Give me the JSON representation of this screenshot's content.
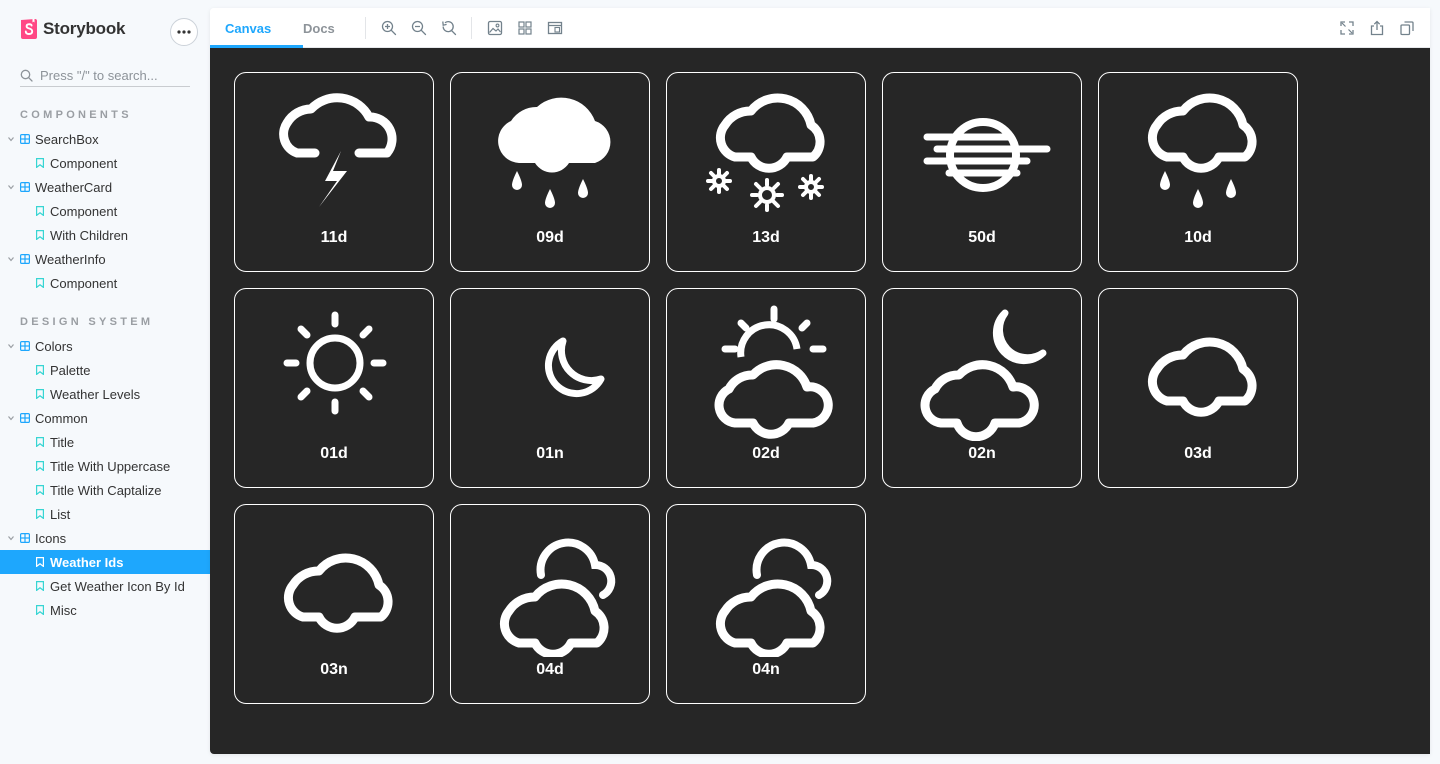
{
  "brand": {
    "name": "Storybook",
    "logo_color": "#ff4785"
  },
  "search": {
    "placeholder": "Press \"/\" to search..."
  },
  "sections": {
    "components": "COMPONENTS",
    "design_system": "DESIGN SYSTEM"
  },
  "tree": {
    "searchbox": "SearchBox",
    "searchbox_component": "Component",
    "weathercard": "WeatherCard",
    "weathercard_component": "Component",
    "weathercard_children": "With Children",
    "weatherinfo": "WeatherInfo",
    "weatherinfo_component": "Component",
    "colors": "Colors",
    "colors_palette": "Palette",
    "colors_levels": "Weather Levels",
    "common": "Common",
    "common_title": "Title",
    "common_upper": "Title With Uppercase",
    "common_capt": "Title With Captalize",
    "common_list": "List",
    "icons": "Icons",
    "icons_ids": "Weather Ids",
    "icons_getby": "Get Weather Icon By Id",
    "icons_misc": "Misc"
  },
  "tabs": {
    "canvas": "Canvas",
    "docs": "Docs"
  },
  "accent_color": "#1ea7fd",
  "canvas_bg": "#262626",
  "weather_icons": [
    {
      "id": "11d",
      "icon": "thunderstorm-icon"
    },
    {
      "id": "09d",
      "icon": "shower-rain-icon"
    },
    {
      "id": "13d",
      "icon": "snow-icon"
    },
    {
      "id": "50d",
      "icon": "mist-icon"
    },
    {
      "id": "10d",
      "icon": "rain-icon"
    },
    {
      "id": "01d",
      "icon": "sun-icon"
    },
    {
      "id": "01n",
      "icon": "moon-icon"
    },
    {
      "id": "02d",
      "icon": "sun-cloud-icon"
    },
    {
      "id": "02n",
      "icon": "moon-cloud-icon"
    },
    {
      "id": "03d",
      "icon": "cloud-icon"
    },
    {
      "id": "03n",
      "icon": "cloud-icon"
    },
    {
      "id": "04d",
      "icon": "broken-clouds-icon"
    },
    {
      "id": "04n",
      "icon": "broken-clouds-icon"
    }
  ]
}
